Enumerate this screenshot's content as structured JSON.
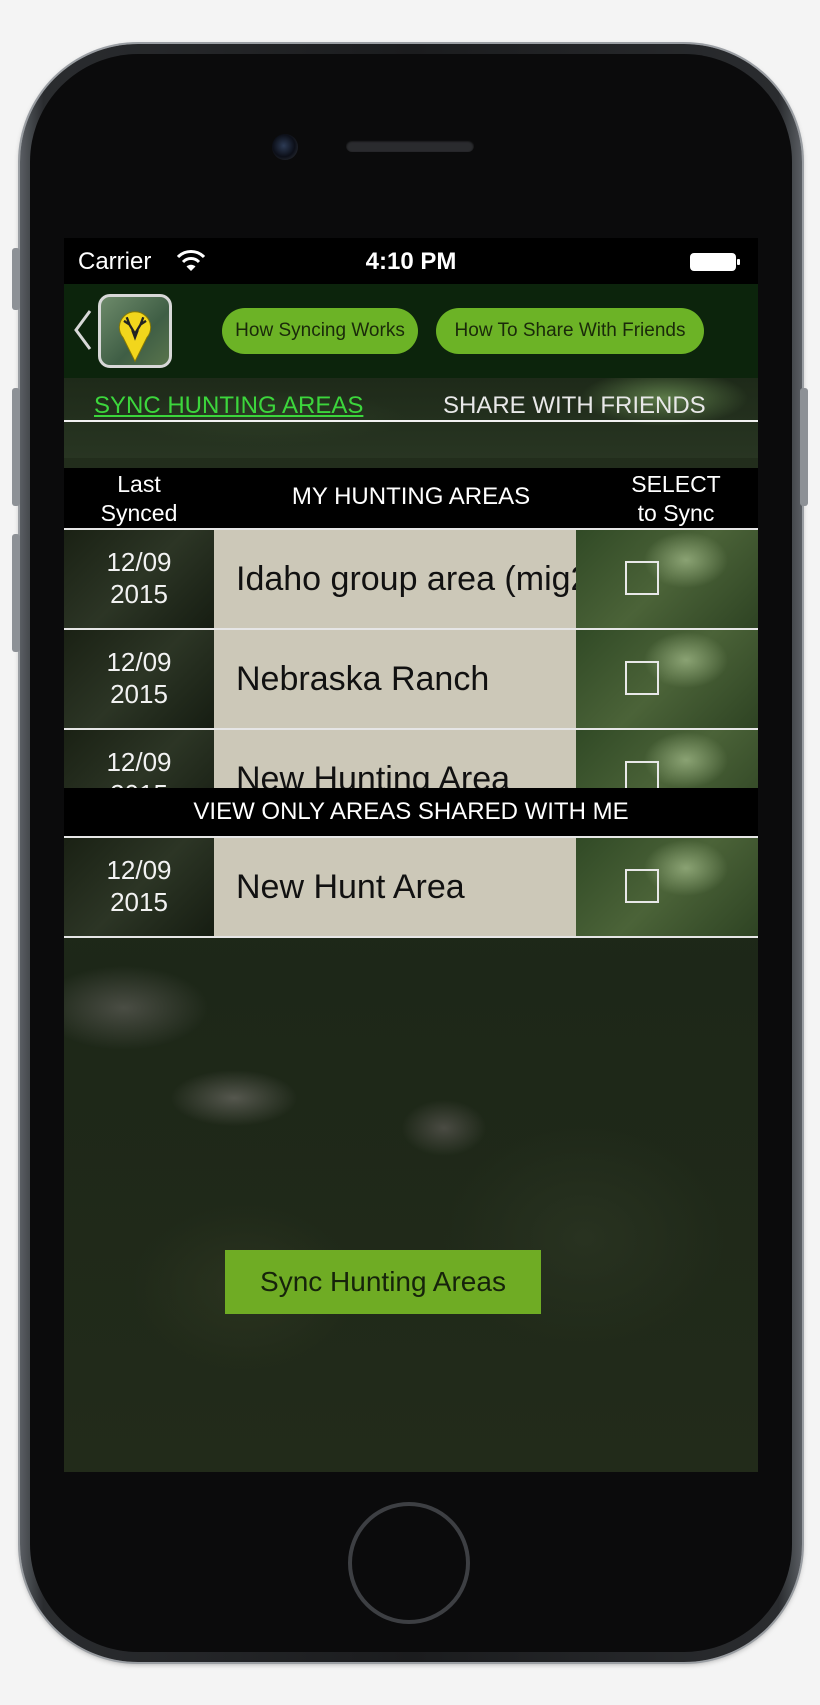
{
  "status_bar": {
    "carrier": "Carrier",
    "time": "4:10 PM"
  },
  "nav": {
    "how_syncing_label": "How Syncing Works",
    "how_share_label": "How To Share With Friends"
  },
  "tabs": {
    "sync_label": "SYNC HUNTING AREAS",
    "share_label": "SHARE WITH FRIENDS"
  },
  "table_header": {
    "last_synced_line1": "Last",
    "last_synced_line2": "Synced",
    "my_areas": "MY HUNTING AREAS",
    "select_line1": "SELECT",
    "select_line2": "to Sync"
  },
  "my_areas": [
    {
      "date_line1": "12/09",
      "date_line2": "2015",
      "name": "Idaho group area (mig2",
      "selected": false
    },
    {
      "date_line1": "12/09",
      "date_line2": "2015",
      "name": "Nebraska Ranch",
      "selected": false
    },
    {
      "date_line1": "12/09",
      "date_line2": "2015",
      "name": "New Hunting Area",
      "selected": false
    }
  ],
  "shared_header": "VIEW ONLY AREAS SHARED WITH ME",
  "shared_areas": [
    {
      "date_line1": "12/09",
      "date_line2": "2015",
      "name": "New Hunt Area",
      "selected": false
    }
  ],
  "sync_button_label": "Sync Hunting Areas",
  "colors": {
    "accent_green": "#6cb326",
    "active_tab": "#3cd63c",
    "row_fill": "#ccc8b8",
    "nav_bg": "#0c240c"
  }
}
